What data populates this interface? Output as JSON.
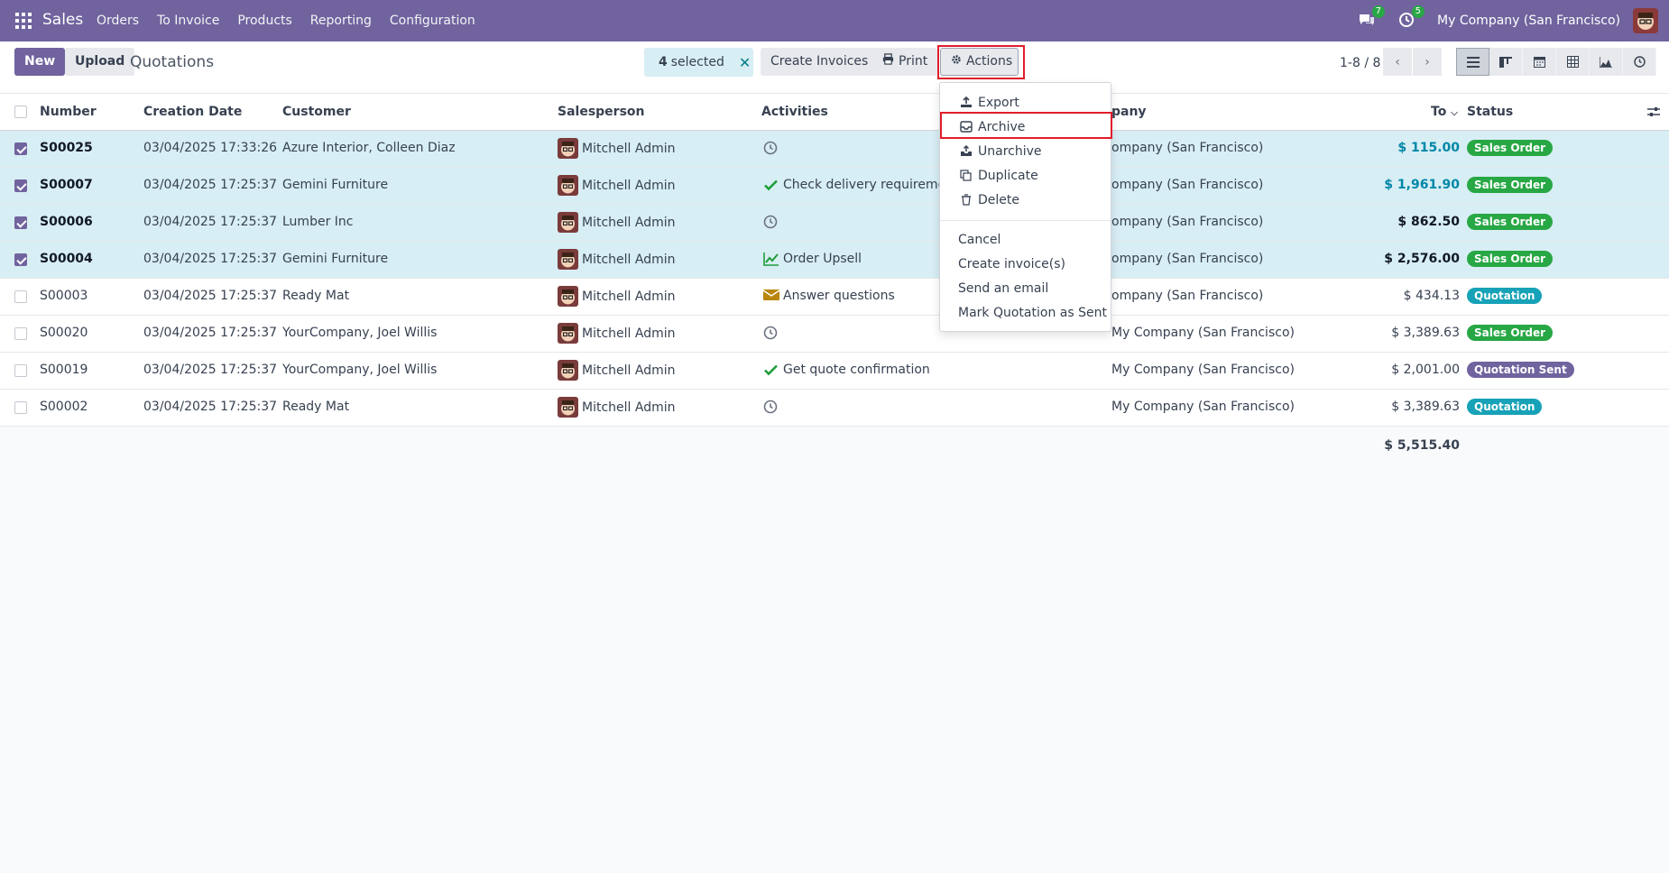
{
  "navbar": {
    "app_name": "Sales",
    "menu": [
      "Orders",
      "To Invoice",
      "Products",
      "Reporting",
      "Configuration"
    ],
    "messages_count": "7",
    "activities_count": "5",
    "company": "My Company (San Francisco)"
  },
  "control": {
    "new_label": "New",
    "upload_label": "Upload",
    "title": "Quotations",
    "selected_count": "4",
    "selected_label": "selected",
    "create_invoices_label": "Create Invoices",
    "print_label": "Print",
    "actions_label": "Actions",
    "pager": "1-8 / 8"
  },
  "table": {
    "headers": {
      "number": "Number",
      "creation_date": "Creation Date",
      "customer": "Customer",
      "salesperson": "Salesperson",
      "activities": "Activities",
      "company": "pany",
      "total": "To",
      "status": "Status"
    },
    "rows": [
      {
        "selected": true,
        "number": "S00025",
        "date": "03/04/2025 17:33:26",
        "customer": "Azure Interior, Colleen Diaz",
        "salesperson": "Mitchell Admin",
        "activity_icon": "clock-icon",
        "activity": "",
        "company": "ompany (San Francisco)",
        "total": "$ 115.00",
        "status": "Sales Order",
        "status_color": "green"
      },
      {
        "selected": true,
        "number": "S00007",
        "date": "03/04/2025 17:25:37",
        "customer": "Gemini Furniture",
        "salesperson": "Mitchell Admin",
        "activity_icon": "check-icon",
        "activity": "Check delivery requirement",
        "company": "ompany (San Francisco)",
        "total": "$ 1,961.90",
        "status": "Sales Order",
        "status_color": "green"
      },
      {
        "selected": true,
        "number": "S00006",
        "date": "03/04/2025 17:25:37",
        "customer": "Lumber Inc",
        "salesperson": "Mitchell Admin",
        "activity_icon": "clock-icon",
        "activity": "",
        "company": "ompany (San Francisco)",
        "total": "$ 862.50",
        "status": "Sales Order",
        "status_color": "green"
      },
      {
        "selected": true,
        "number": "S00004",
        "date": "03/04/2025 17:25:37",
        "customer": "Gemini Furniture",
        "salesperson": "Mitchell Admin",
        "activity_icon": "chart-icon",
        "activity": "Order Upsell",
        "company": "ompany (San Francisco)",
        "total": "$ 2,576.00",
        "status": "Sales Order",
        "status_color": "green"
      },
      {
        "selected": false,
        "number": "S00003",
        "date": "03/04/2025 17:25:37",
        "customer": "Ready Mat",
        "salesperson": "Mitchell Admin",
        "activity_icon": "envelope-icon",
        "activity": "Answer questions",
        "company": "ompany (San Francisco)",
        "total": "$ 434.13",
        "status": "Quotation",
        "status_color": "cyan"
      },
      {
        "selected": false,
        "number": "S00020",
        "date": "03/04/2025 17:25:37",
        "customer": "YourCompany, Joel Willis",
        "salesperson": "Mitchell Admin",
        "activity_icon": "clock-icon",
        "activity": "",
        "company": "My Company (San Francisco)",
        "total": "$ 3,389.63",
        "status": "Sales Order",
        "status_color": "green"
      },
      {
        "selected": false,
        "number": "S00019",
        "date": "03/04/2025 17:25:37",
        "customer": "YourCompany, Joel Willis",
        "salesperson": "Mitchell Admin",
        "activity_icon": "check-icon",
        "activity": "Get quote confirmation",
        "company": "My Company (San Francisco)",
        "total": "$ 2,001.00",
        "status": "Quotation Sent",
        "status_color": "purple"
      },
      {
        "selected": false,
        "number": "S00002",
        "date": "03/04/2025 17:25:37",
        "customer": "Ready Mat",
        "salesperson": "Mitchell Admin",
        "activity_icon": "clock-icon",
        "activity": "",
        "company": "My Company (San Francisco)",
        "total": "$ 3,389.63",
        "status": "Quotation",
        "status_color": "cyan"
      }
    ],
    "grand_total": "$ 5,515.40"
  },
  "actions_menu": {
    "export": "Export",
    "archive": "Archive",
    "unarchive": "Unarchive",
    "duplicate": "Duplicate",
    "delete": "Delete",
    "cancel": "Cancel",
    "create_invoices": "Create invoice(s)",
    "send_email": "Send an email",
    "mark_sent": "Mark Quotation as Sent"
  },
  "colors": {
    "brand": "#71639e",
    "selected_row": "#d7eef4",
    "highlight": "#e11d2b"
  }
}
